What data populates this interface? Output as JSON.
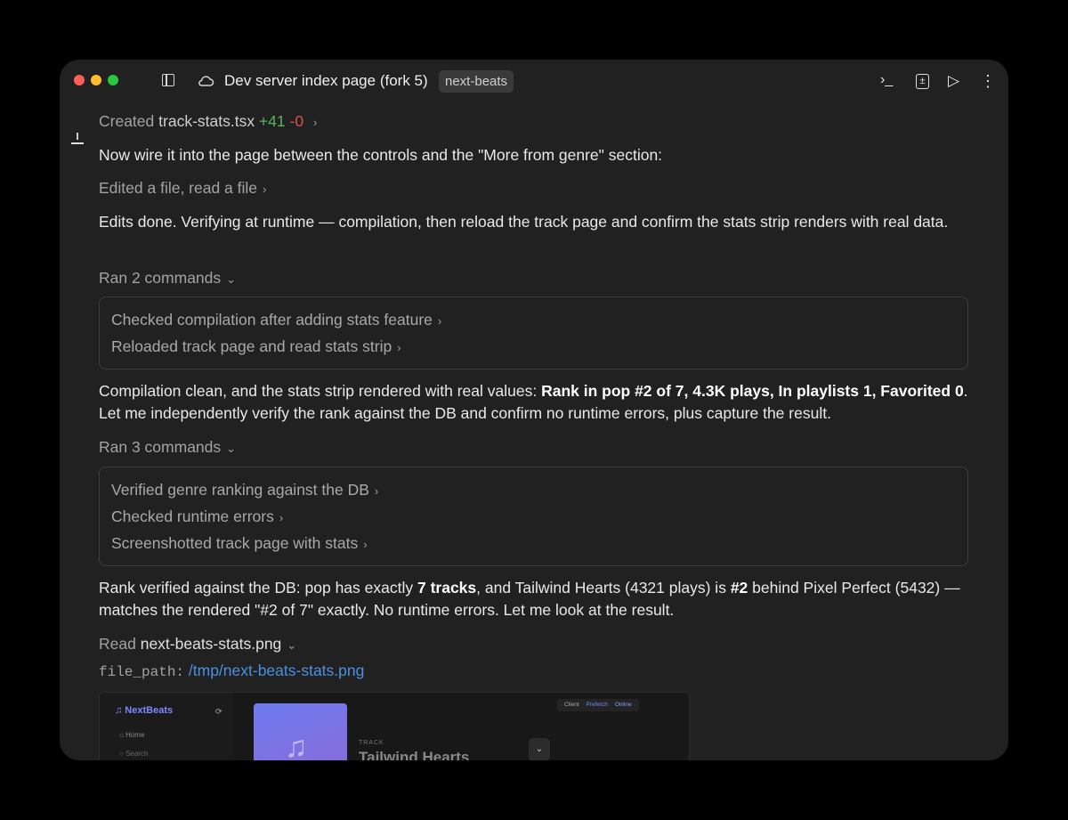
{
  "window": {
    "title": "Dev server index page (fork 5)",
    "badge": "next-beats",
    "icons": [
      "sidebar-toggle-icon",
      "cloud-icon",
      "terminal-icon",
      "diff-icon",
      "play-icon",
      "more-icon"
    ],
    "terminal_glyph": "›_",
    "diff_glyph": "±",
    "play_glyph": "▷",
    "more_glyph": "⋮"
  },
  "chat": {
    "created": {
      "prefix": "Created",
      "file": "track-stats.tsx",
      "added": "+41",
      "removed": "-0"
    },
    "msg1": "Now wire it into the page between the controls and the \"More from genre\" section:",
    "edited": "Edited a file, read a file",
    "msg2": "Edits done. Verifying at runtime — compilation, then reload the track page and confirm the stats strip renders with real data.",
    "ran1": {
      "label": "Ran 2 commands",
      "items": [
        "Checked compilation after adding stats feature",
        "Reloaded track page and read stats strip"
      ]
    },
    "msg3": {
      "a": "Compilation clean, and the stats strip rendered with real values: ",
      "b": "Rank in pop #2 of 7, 4.3K plays, In playlists 1, Favorited 0",
      "c": ". Let me independently verify the rank against the DB and confirm no runtime errors, plus capture the result."
    },
    "ran2": {
      "label": "Ran 3 commands",
      "items": [
        "Verified genre ranking against the DB",
        "Checked runtime errors",
        "Screenshotted track page with stats"
      ]
    },
    "msg4": {
      "a": "Rank verified against the DB: pop has exactly ",
      "b": "7 tracks",
      "c": ", and Tailwind Hearts (4321 plays) is ",
      "d": "#2",
      "e": " behind Pixel Perfect (5432) — matches the rendered \"#2 of 7\" exactly. No runtime errors. Let me look at the result."
    },
    "read": {
      "prefix": "Read",
      "file": "next-beats-stats.png"
    },
    "file_path": {
      "key": "file_path:",
      "value": "/tmp/next-beats-stats.png"
    }
  },
  "preview": {
    "logo": "♫ NextBeats",
    "home": "Home",
    "search": "Search",
    "pills": [
      "Client",
      "Prefetch",
      "Online"
    ],
    "track_label": "TRACK",
    "track_title": "Tailwind Hearts"
  }
}
